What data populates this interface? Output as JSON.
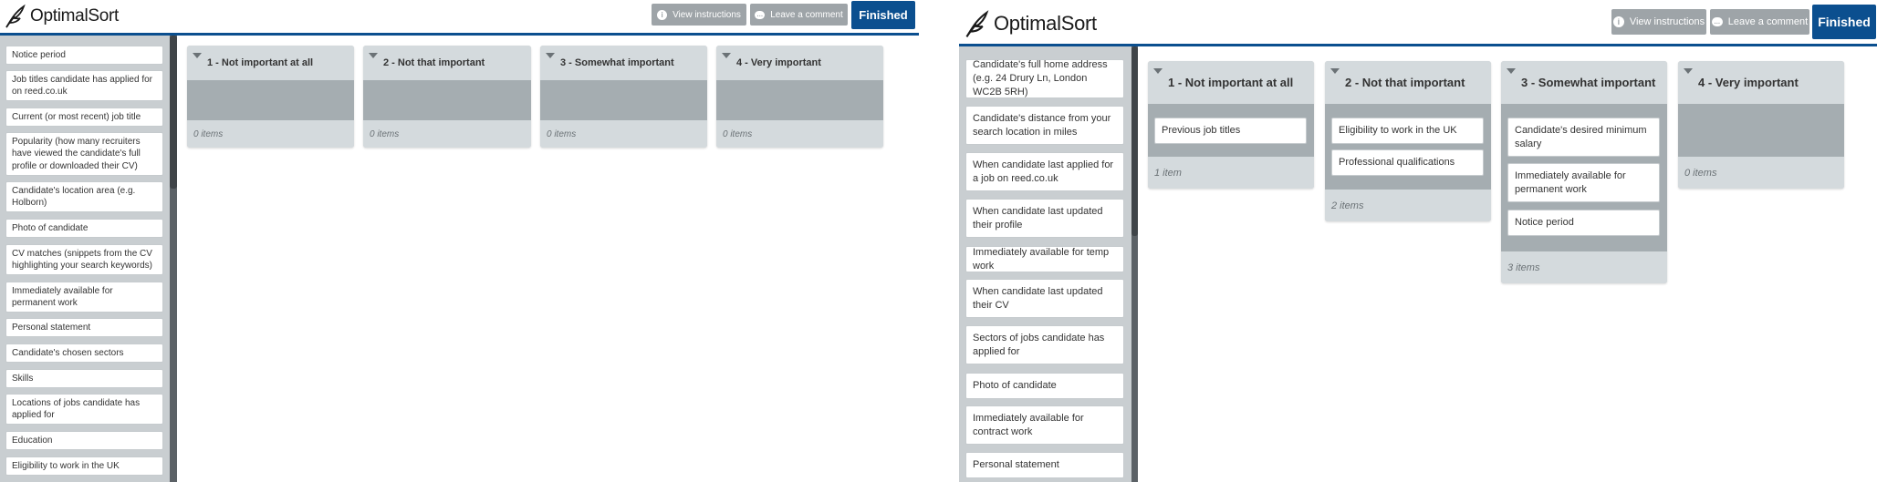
{
  "app": {
    "logo_text": "OptimalSort",
    "view_instructions": "View instructions",
    "leave_comment": "Leave a comment",
    "finished": "Finished"
  },
  "categories": {
    "c1": "1 - Not important at all",
    "c2": "2 - Not that important",
    "c3": "3 - Somewhat important",
    "c4": "4 - Very important"
  },
  "left": {
    "cards": [
      "Notice period",
      "Job titles candidate has applied for on reed.co.uk",
      "Current (or most recent) job title",
      "Popularity (how many recruiters have viewed the candidate's full profile or downloaded their CV)",
      "Candidate's location area (e.g. Holborn)",
      "Photo of candidate",
      "CV matches (snippets from the CV highlighting your search keywords)",
      "Immediately available for permanent work",
      "Personal statement",
      "Candidate's chosen sectors",
      "Skills",
      "Locations of jobs candidate has applied for",
      "Education",
      "Eligibility to work in the UK"
    ],
    "counts": [
      "0 items",
      "0 items",
      "0 items",
      "0 items"
    ]
  },
  "right": {
    "cards": [
      "Candidate's full home address (e.g. 24 Drury Ln, London WC2B 5RH)",
      "Candidate's distance from your search location in miles",
      "When candidate last applied for a job on reed.co.uk",
      "When candidate last updated their profile",
      "Immediately available for temp work",
      "When candidate last updated their CV",
      "Sectors of jobs candidate has applied for",
      "Photo of candidate",
      "Immediately available for contract work",
      "Personal statement"
    ],
    "cat1_items": [
      "Previous job titles"
    ],
    "cat2_items": [
      "Eligibility to work in the UK",
      "Professional qualifications"
    ],
    "cat3_items": [
      "Candidate's desired minimum salary",
      "Immediately available for permanent work",
      "Notice period"
    ],
    "counts": [
      "1 item",
      "2 items",
      "3 items",
      "0 items"
    ]
  }
}
